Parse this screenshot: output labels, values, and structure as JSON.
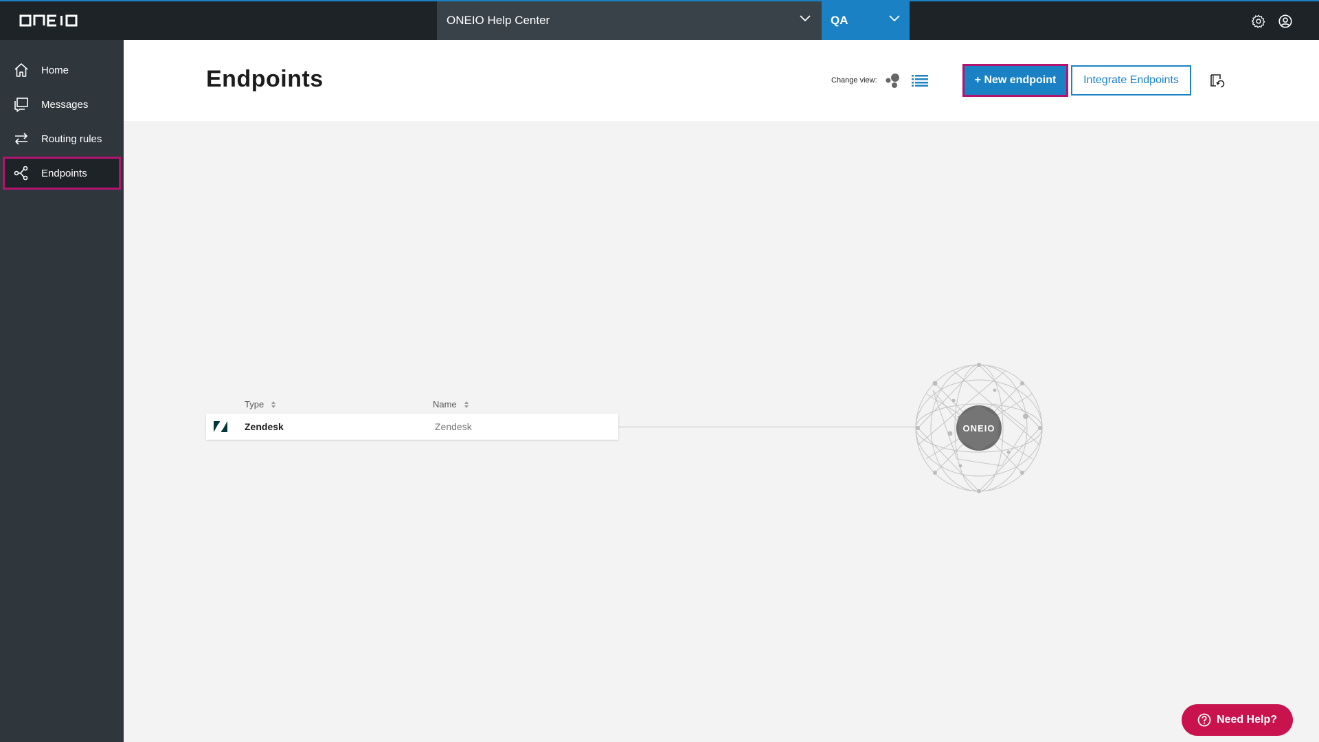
{
  "app": {
    "logo_text": "ONEIO"
  },
  "topbar": {
    "org_selector": "ONEIO Help Center",
    "env_selector": "QA"
  },
  "sidebar": {
    "items": [
      {
        "label": "Home",
        "icon": "home-icon",
        "active": false
      },
      {
        "label": "Messages",
        "icon": "messages-icon",
        "active": false
      },
      {
        "label": "Routing rules",
        "icon": "routing-icon",
        "active": false
      },
      {
        "label": "Endpoints",
        "icon": "endpoints-icon",
        "active": true
      }
    ]
  },
  "header": {
    "title": "Endpoints",
    "change_view_label": "Change view:",
    "new_endpoint_button": "+ New endpoint",
    "integrate_button": "Integrate Endpoints"
  },
  "table": {
    "columns": [
      "Type",
      "Name"
    ],
    "rows": [
      {
        "type": "Zendesk",
        "name": "Zendesk",
        "icon": "zendesk-icon"
      }
    ]
  },
  "hub": {
    "label": "ONEIO"
  },
  "help_button": "Need Help?",
  "colors": {
    "accent_blue": "#1a82c4",
    "highlight": "#b5136f",
    "help_red": "#c9134f",
    "sidebar_bg": "#2f363c",
    "topbar_bg": "#1e2327"
  }
}
